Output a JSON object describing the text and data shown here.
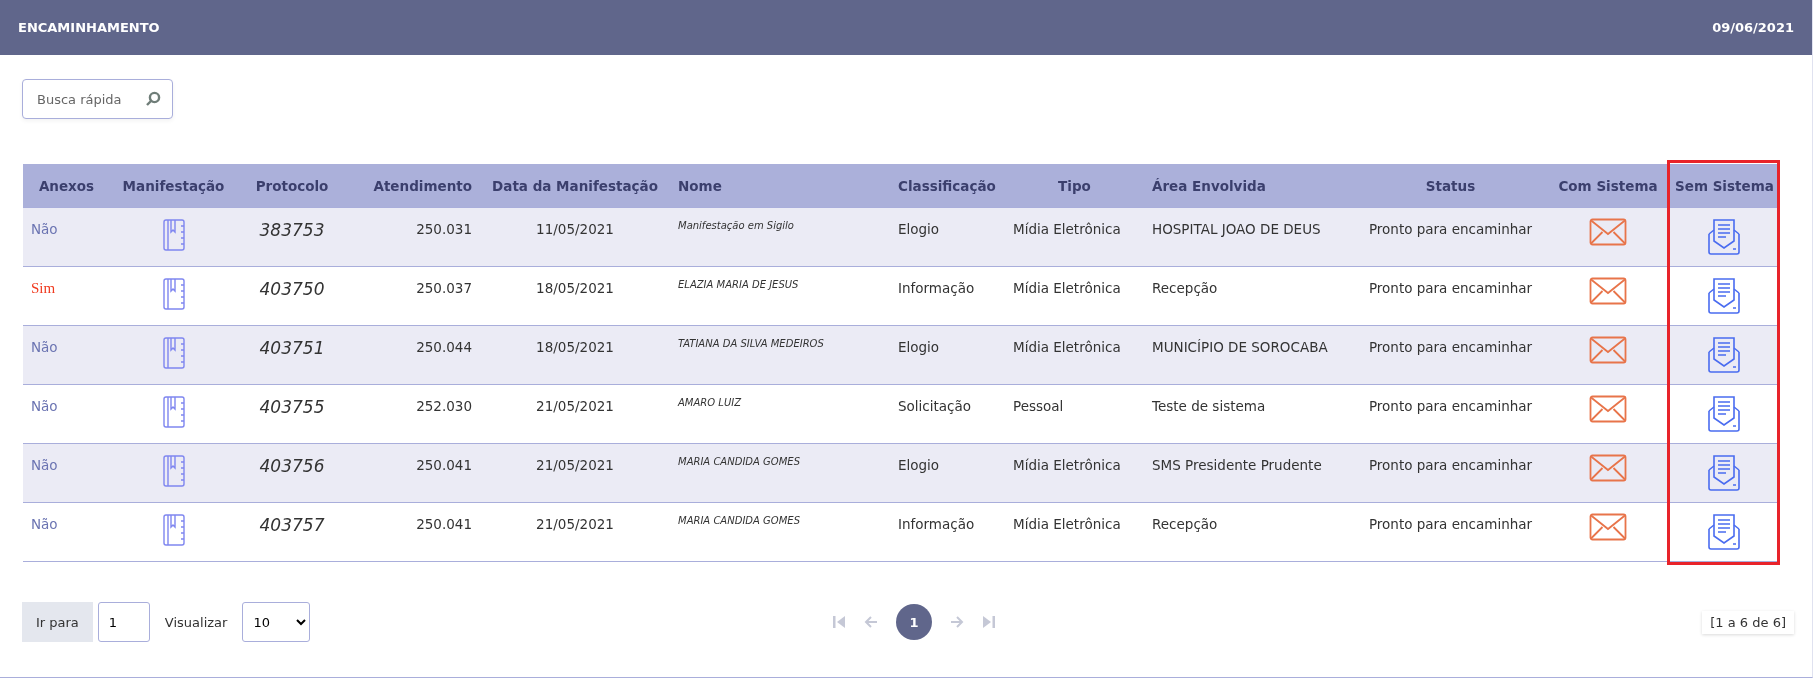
{
  "header": {
    "title": "ENCAMINHAMENTO",
    "date": "09/06/2021"
  },
  "search": {
    "placeholder": "Busca rápida"
  },
  "table": {
    "columns": [
      {
        "label": "Anexos",
        "highlighted": false
      },
      {
        "label": "Manifestação",
        "highlighted": false
      },
      {
        "label": "Protocolo",
        "highlighted": false
      },
      {
        "label": "Atendimento",
        "highlighted": false
      },
      {
        "label": "Data da Manifestação",
        "highlighted": false
      },
      {
        "label": "Nome",
        "highlighted": false
      },
      {
        "label": "Classificação",
        "highlighted": false
      },
      {
        "label": "Tipo",
        "highlighted": false
      },
      {
        "label": "Área Envolvida",
        "highlighted": false
      },
      {
        "label": "Status",
        "highlighted": false
      },
      {
        "label": "Com Sistema",
        "highlighted": false
      },
      {
        "label": "Sem Sistema",
        "highlighted": true
      }
    ],
    "rows": [
      {
        "anexos": "Não",
        "has_attachments": false,
        "protocolo": "383753",
        "atendimento": "250.031",
        "data": "11/05/2021",
        "nome": "Manifestação em Sigilo",
        "classificacao": "Elogio",
        "tipo": "Mídia Eletrônica",
        "area": "HOSPITAL JOAO DE DEUS",
        "status": "Pronto para encaminhar"
      },
      {
        "anexos": "Sim",
        "has_attachments": true,
        "protocolo": "403750",
        "atendimento": "250.037",
        "data": "18/05/2021",
        "nome": "ELAZIA MARIA DE JESUS",
        "classificacao": "Informação",
        "tipo": "Mídia Eletrônica",
        "area": "Recepção",
        "status": "Pronto para encaminhar"
      },
      {
        "anexos": "Não",
        "has_attachments": false,
        "protocolo": "403751",
        "atendimento": "250.044",
        "data": "18/05/2021",
        "nome": "TATIANA DA SILVA MEDEIROS",
        "classificacao": "Elogio",
        "tipo": "Mídia Eletrônica",
        "area": "MUNICÍPIO DE SOROCABA",
        "status": "Pronto para encaminhar"
      },
      {
        "anexos": "Não",
        "has_attachments": false,
        "protocolo": "403755",
        "atendimento": "252.030",
        "data": "21/05/2021",
        "nome": "AMARO LUIZ",
        "classificacao": "Solicitação",
        "tipo": "Pessoal",
        "area": "Teste de sistema",
        "status": "Pronto para encaminhar"
      },
      {
        "anexos": "Não",
        "has_attachments": false,
        "protocolo": "403756",
        "atendimento": "250.041",
        "data": "21/05/2021",
        "nome": "MARIA CANDIDA GOMES",
        "classificacao": "Elogio",
        "tipo": "Mídia Eletrônica",
        "area": "SMS Presidente Prudente",
        "status": "Pronto para encaminhar"
      },
      {
        "anexos": "Não",
        "has_attachments": false,
        "protocolo": "403757",
        "atendimento": "250.041",
        "data": "21/05/2021",
        "nome": "MARIA CANDIDA GOMES",
        "classificacao": "Informação",
        "tipo": "Mídia Eletrônica",
        "area": "Recepção",
        "status": "Pronto para encaminhar"
      }
    ]
  },
  "footer": {
    "goto_label": "Ir para",
    "goto_value": "1",
    "view_label": "Visualizar",
    "page_size": "10",
    "pages": [
      {
        "label": "1",
        "selected": true
      }
    ],
    "summary": "[1 a 6 de 6]"
  }
}
